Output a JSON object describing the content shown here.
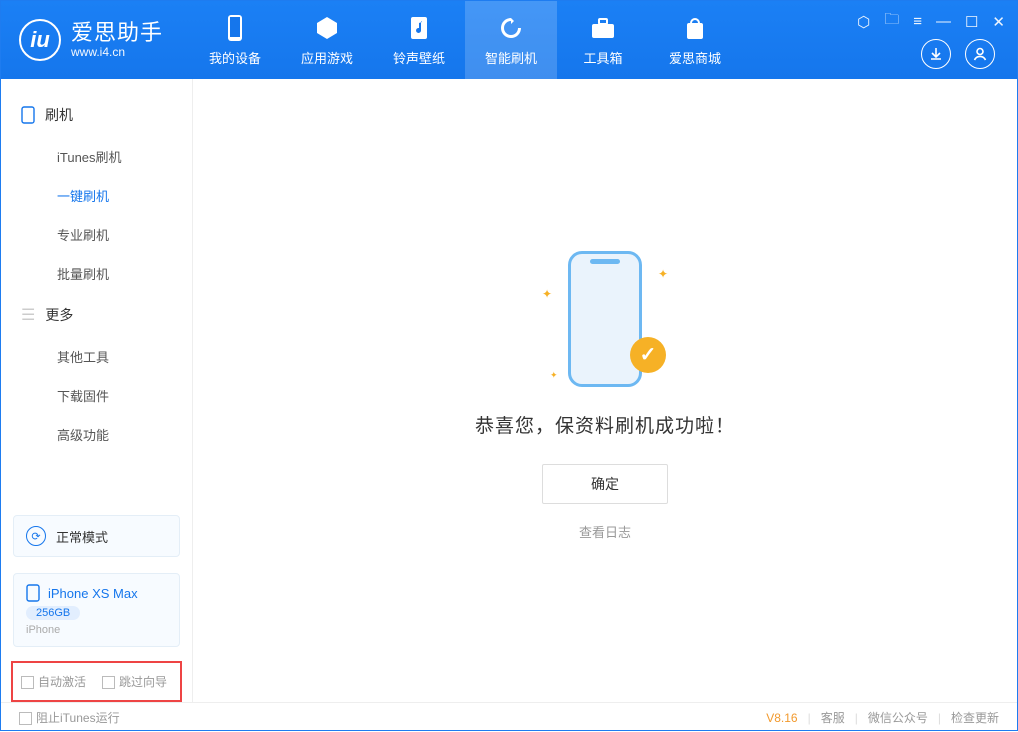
{
  "app": {
    "name": "爱思助手",
    "url": "www.i4.cn",
    "logo_char": "iu"
  },
  "nav": [
    {
      "id": "device",
      "label": "我的设备"
    },
    {
      "id": "apps",
      "label": "应用游戏"
    },
    {
      "id": "ring",
      "label": "铃声壁纸"
    },
    {
      "id": "flash",
      "label": "智能刷机"
    },
    {
      "id": "tools",
      "label": "工具箱"
    },
    {
      "id": "store",
      "label": "爱思商城"
    }
  ],
  "sidebar": {
    "sec1": "刷机",
    "items1": [
      "iTunes刷机",
      "一键刷机",
      "专业刷机",
      "批量刷机"
    ],
    "sec2": "更多",
    "items2": [
      "其他工具",
      "下载固件",
      "高级功能"
    ]
  },
  "mode": {
    "label": "正常模式"
  },
  "device": {
    "name": "iPhone XS Max",
    "storage": "256GB",
    "type": "iPhone"
  },
  "checks": {
    "auto_activate": "自动激活",
    "skip_guide": "跳过向导"
  },
  "main": {
    "success": "恭喜您，保资料刷机成功啦！",
    "ok": "确定",
    "view_log": "查看日志"
  },
  "status": {
    "block_itunes": "阻止iTunes运行",
    "version": "V8.16",
    "support": "客服",
    "wechat": "微信公众号",
    "update": "检查更新"
  }
}
